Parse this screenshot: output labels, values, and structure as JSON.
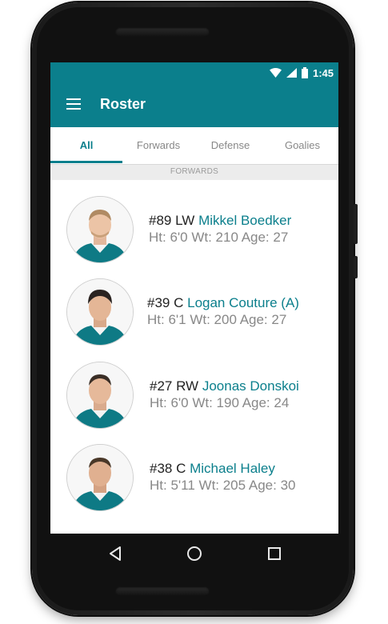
{
  "status": {
    "time": "1:45",
    "icons": [
      "wifi-icon",
      "signal-icon",
      "battery-icon"
    ]
  },
  "appbar": {
    "title": "Roster",
    "menu_icon": "menu-icon"
  },
  "tabs": [
    {
      "label": "All",
      "active": true
    },
    {
      "label": "Forwards",
      "active": false
    },
    {
      "label": "Defense",
      "active": false
    },
    {
      "label": "Goalies",
      "active": false
    }
  ],
  "section": {
    "label": "FORWARDS"
  },
  "players": [
    {
      "number_pos": "#89 LW",
      "name": "Mikkel Boedker",
      "stats": "Ht: 6'0 Wt: 210 Age: 27"
    },
    {
      "number_pos": "#39 C",
      "name": "Logan Couture (A)",
      "stats": "Ht: 6'1 Wt: 200 Age: 27"
    },
    {
      "number_pos": "#27 RW",
      "name": "Joonas Donskoi",
      "stats": "Ht: 6'0 Wt: 190 Age: 24"
    },
    {
      "number_pos": "#38 C",
      "name": "Michael Haley",
      "stats": "Ht: 5'11 Wt: 205 Age: 30"
    }
  ],
  "nav": {
    "back_icon": "back-icon",
    "home_icon": "home-icon",
    "recents_icon": "recents-icon"
  },
  "colors": {
    "accent": "#0b7f8c",
    "jersey": "#0e7a85"
  }
}
